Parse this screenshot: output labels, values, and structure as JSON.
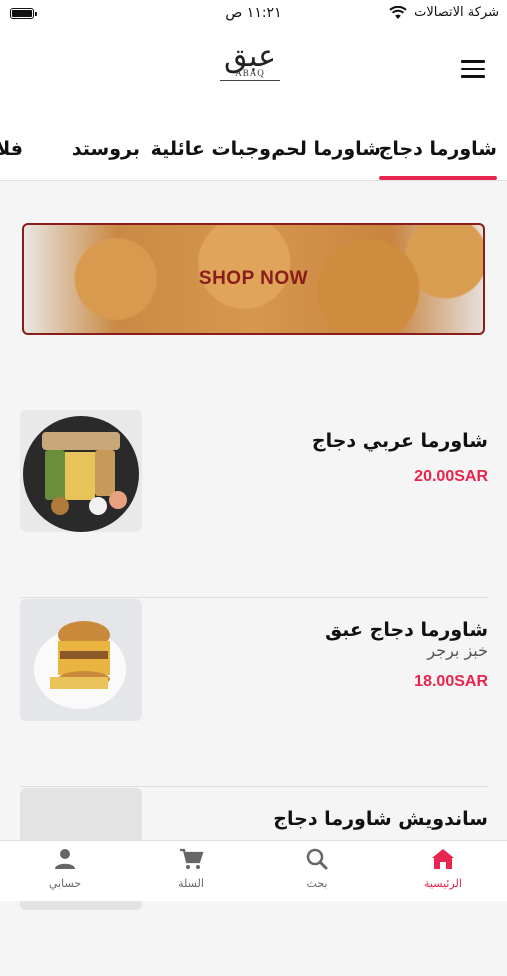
{
  "status_bar": {
    "carrier": "شركة الاتصالات",
    "time": "١١:٢١ ص"
  },
  "header": {
    "logo_ar": "عبق",
    "logo_en": "ABAQ"
  },
  "tabs": [
    {
      "label": "شاورما دجاج",
      "active": true
    },
    {
      "label": "شاورما لحم",
      "active": false
    },
    {
      "label": "وجبات عائلية",
      "active": false
    },
    {
      "label": "بروستد",
      "active": false
    },
    {
      "label": "فلا",
      "active": false
    }
  ],
  "banner": {
    "text": "SHOP NOW"
  },
  "products": [
    {
      "name": "شاورما عربي دجاج",
      "desc": "",
      "price": "20.00SAR"
    },
    {
      "name": "شاورما دجاج عبق",
      "desc": "خبز برجر",
      "price": "18.00SAR"
    },
    {
      "name": "ساندويش شاورما دجاج",
      "desc": "",
      "price": ""
    }
  ],
  "bottom_nav": [
    {
      "label": "الرئيسية",
      "icon": "home-icon",
      "active": true
    },
    {
      "label": "بحث",
      "icon": "search-icon",
      "active": false
    },
    {
      "label": "السلة",
      "icon": "cart-icon",
      "active": false
    },
    {
      "label": "حسابي",
      "icon": "person-icon",
      "active": false
    }
  ],
  "colors": {
    "accent": "#e8254e",
    "banner_border": "#8a1c1c"
  }
}
